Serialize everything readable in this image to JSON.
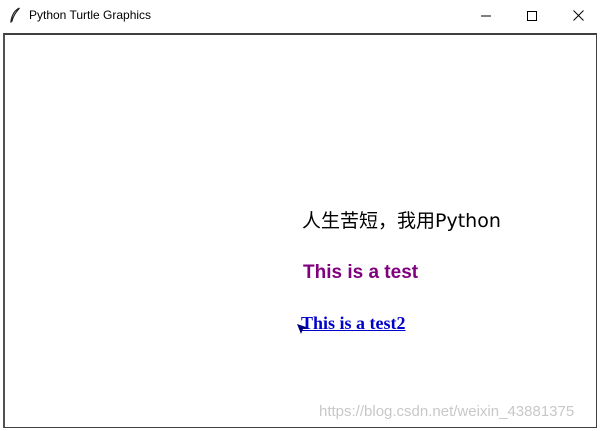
{
  "window": {
    "title": "Python Turtle Graphics",
    "icons": {
      "app": "feather-icon",
      "minimize": "minimize-icon",
      "maximize": "maximize-icon",
      "close": "close-icon"
    }
  },
  "canvas": {
    "texts": [
      {
        "text": "人生苦短，我用Python",
        "color": "#000000"
      },
      {
        "text": "This is a test",
        "color": "#800080"
      },
      {
        "text": "This is a test2",
        "color": "#0000cc"
      }
    ],
    "cursor": {
      "icon": "turtle-arrow-icon",
      "color": "#000080"
    },
    "watermark": "https://blog.csdn.net/weixin_43881375"
  }
}
